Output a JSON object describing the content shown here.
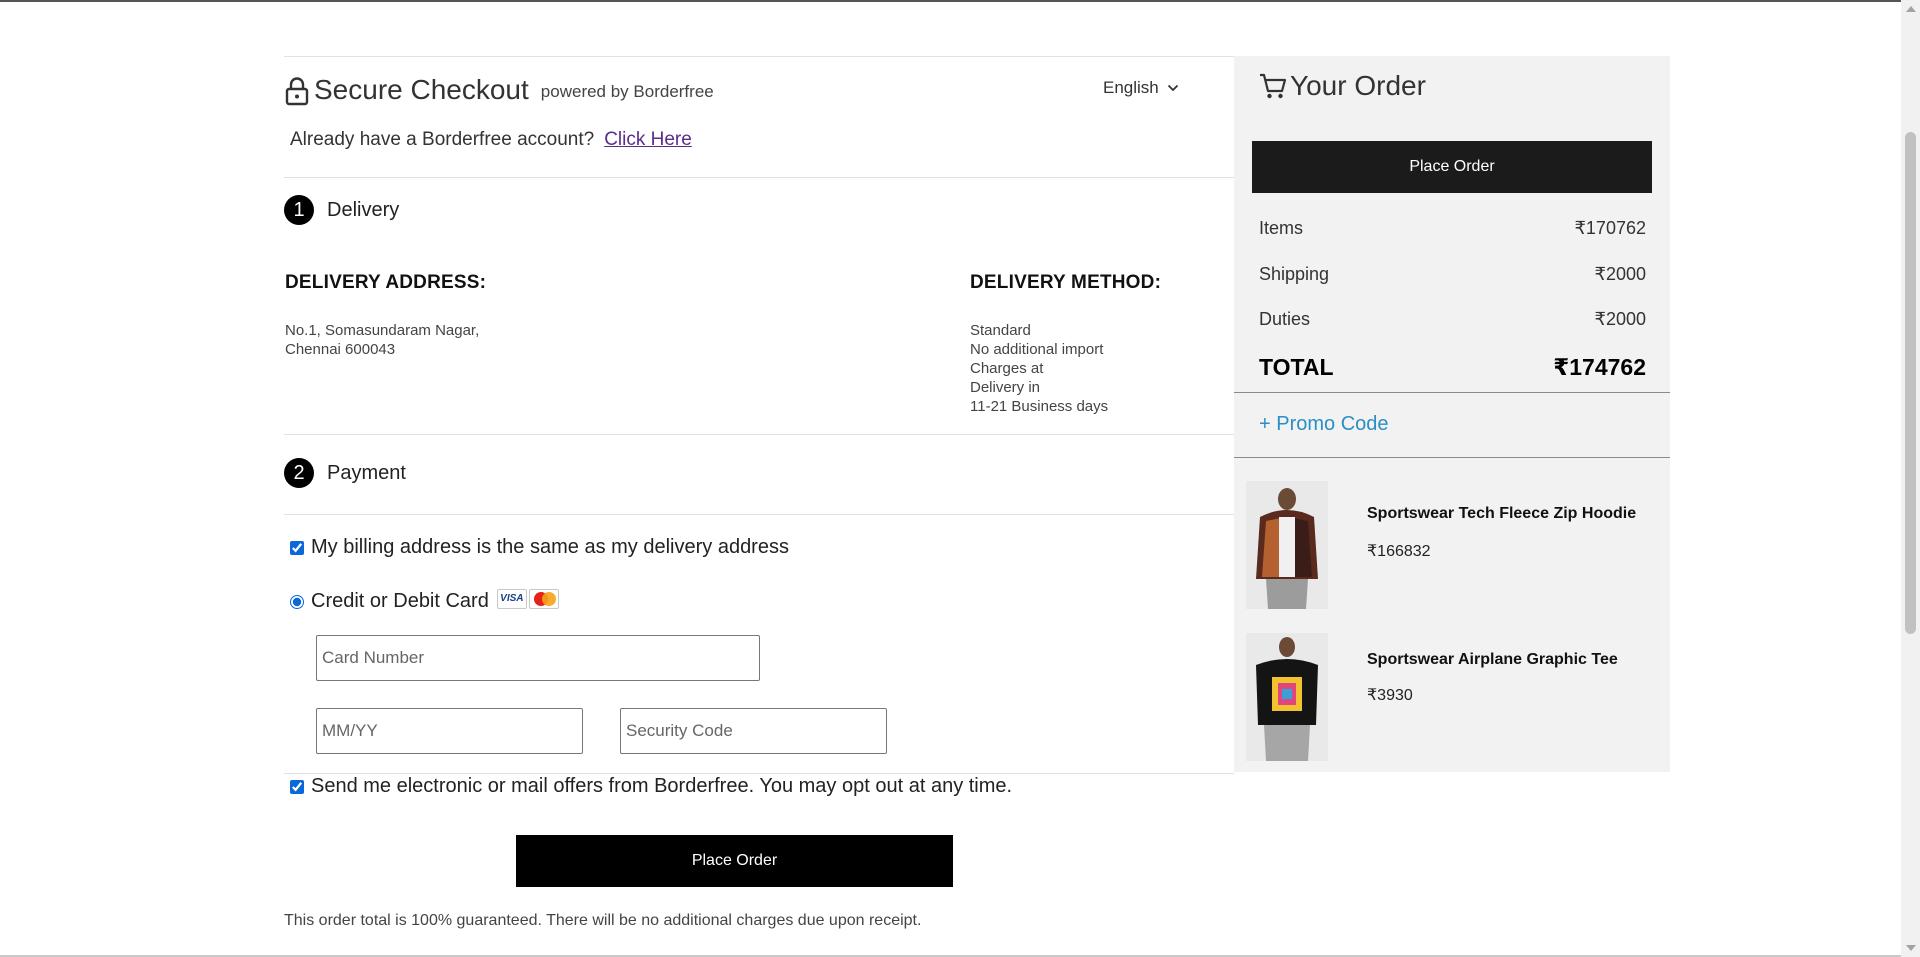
{
  "header": {
    "title": "Secure Checkout",
    "powered_by": "powered by Borderfree",
    "language": "English",
    "account_prompt": "Already have a Borderfree account?",
    "account_link": "Click Here"
  },
  "delivery": {
    "step_number": "1",
    "step_label": "Delivery",
    "address_heading": "DELIVERY ADDRESS:",
    "address_lines": [
      "No.1, Somasundaram Nagar,",
      "Chennai 600043"
    ],
    "method_heading": "DELIVERY METHOD:",
    "method_lines": [
      "Standard",
      "No additional import",
      "Charges at",
      "Delivery in",
      "11-21 Business days"
    ]
  },
  "payment": {
    "step_number": "2",
    "step_label": "Payment",
    "billing_same_label": "My billing address is the same as my delivery address",
    "billing_same_checked": true,
    "card_option_label": "Credit or Debit Card",
    "card_option_selected": true,
    "card_brands": [
      "VISA",
      "MasterCard"
    ],
    "card_number_placeholder": "Card Number",
    "expiry_placeholder": "MM/YY",
    "security_code_placeholder": "Security Code",
    "offers_label": "Send me electronic or mail offers from Borderfree. You may opt out at any time.",
    "offers_checked": true,
    "place_order_label": "Place Order",
    "guarantee_text": "This order total is 100% guaranteed. There will be no additional charges due upon receipt."
  },
  "order": {
    "title": "Your Order",
    "place_order_label": "Place Order",
    "summary": [
      {
        "label": "Items",
        "value": "₹170762"
      },
      {
        "label": "Shipping",
        "value": "₹2000"
      },
      {
        "label": "Duties",
        "value": "₹2000"
      }
    ],
    "total_label": "TOTAL",
    "total_value": "₹174762",
    "promo_label": "+ Promo Code",
    "items": [
      {
        "name": "Sportswear Tech Fleece Zip Hoodie",
        "price": "₹166832"
      },
      {
        "name": "Sportswear Airplane Graphic Tee",
        "price": "₹3930"
      }
    ]
  },
  "colors": {
    "button_bg": "#000000",
    "link_purple": "#5a2d8a",
    "promo_blue": "#2a8fc5",
    "panel_bg": "#f2f2f2"
  }
}
